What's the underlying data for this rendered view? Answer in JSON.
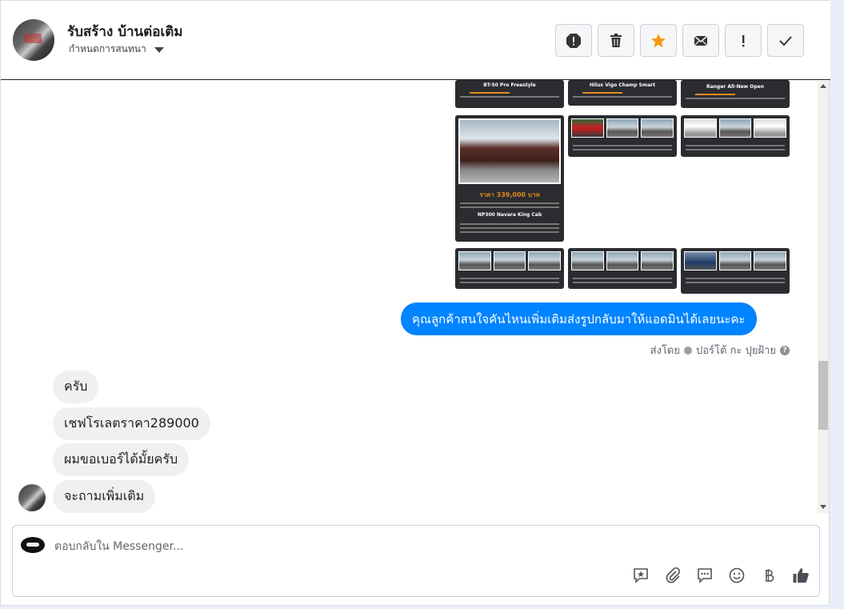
{
  "header": {
    "title": "รับสร้าง บ้านต่อเติม",
    "subtitle": "กำหนดการสนทนา"
  },
  "actions": [
    {
      "name": "report-icon"
    },
    {
      "name": "trash-icon"
    },
    {
      "name": "star-icon",
      "color": "#f39c12"
    },
    {
      "name": "envelope-icon"
    },
    {
      "name": "exclamation-icon"
    },
    {
      "name": "check-icon"
    }
  ],
  "thumbnails": {
    "top_row": [
      "BT-50 Pro Freestyle",
      "Hilux Vigo Champ Smart",
      "Ranger All-New Open"
    ],
    "featured_price": "ราคา 339,000 บาท",
    "featured_model": "NP300 Navara King Cab"
  },
  "messages": {
    "outgoing": "คุณลูกค้าสนใจคันไหนเพิ่มเติมส่งรูปกลับมาให้แอดมินได้เลยนะคะ",
    "sent_by_prefix": "ส่งโดย",
    "sent_by_name": "ปอร์โต้ กะ ปุยฝ้าย",
    "incoming": [
      "ครับ",
      "เชฟโรเลตราคา289000",
      "ผมขอเบอร์ได้มั้ยครับ",
      "จะถามเพิ่มเติม"
    ]
  },
  "composer": {
    "placeholder": "ตอบกลับใน Messenger...",
    "tools": [
      "saved-reply-icon",
      "attachment-icon",
      "chat-icon",
      "emoji-icon",
      "baht-icon",
      "thumbs-up-icon"
    ]
  },
  "colors": {
    "accent": "#0084ff",
    "star": "#f39c12"
  }
}
